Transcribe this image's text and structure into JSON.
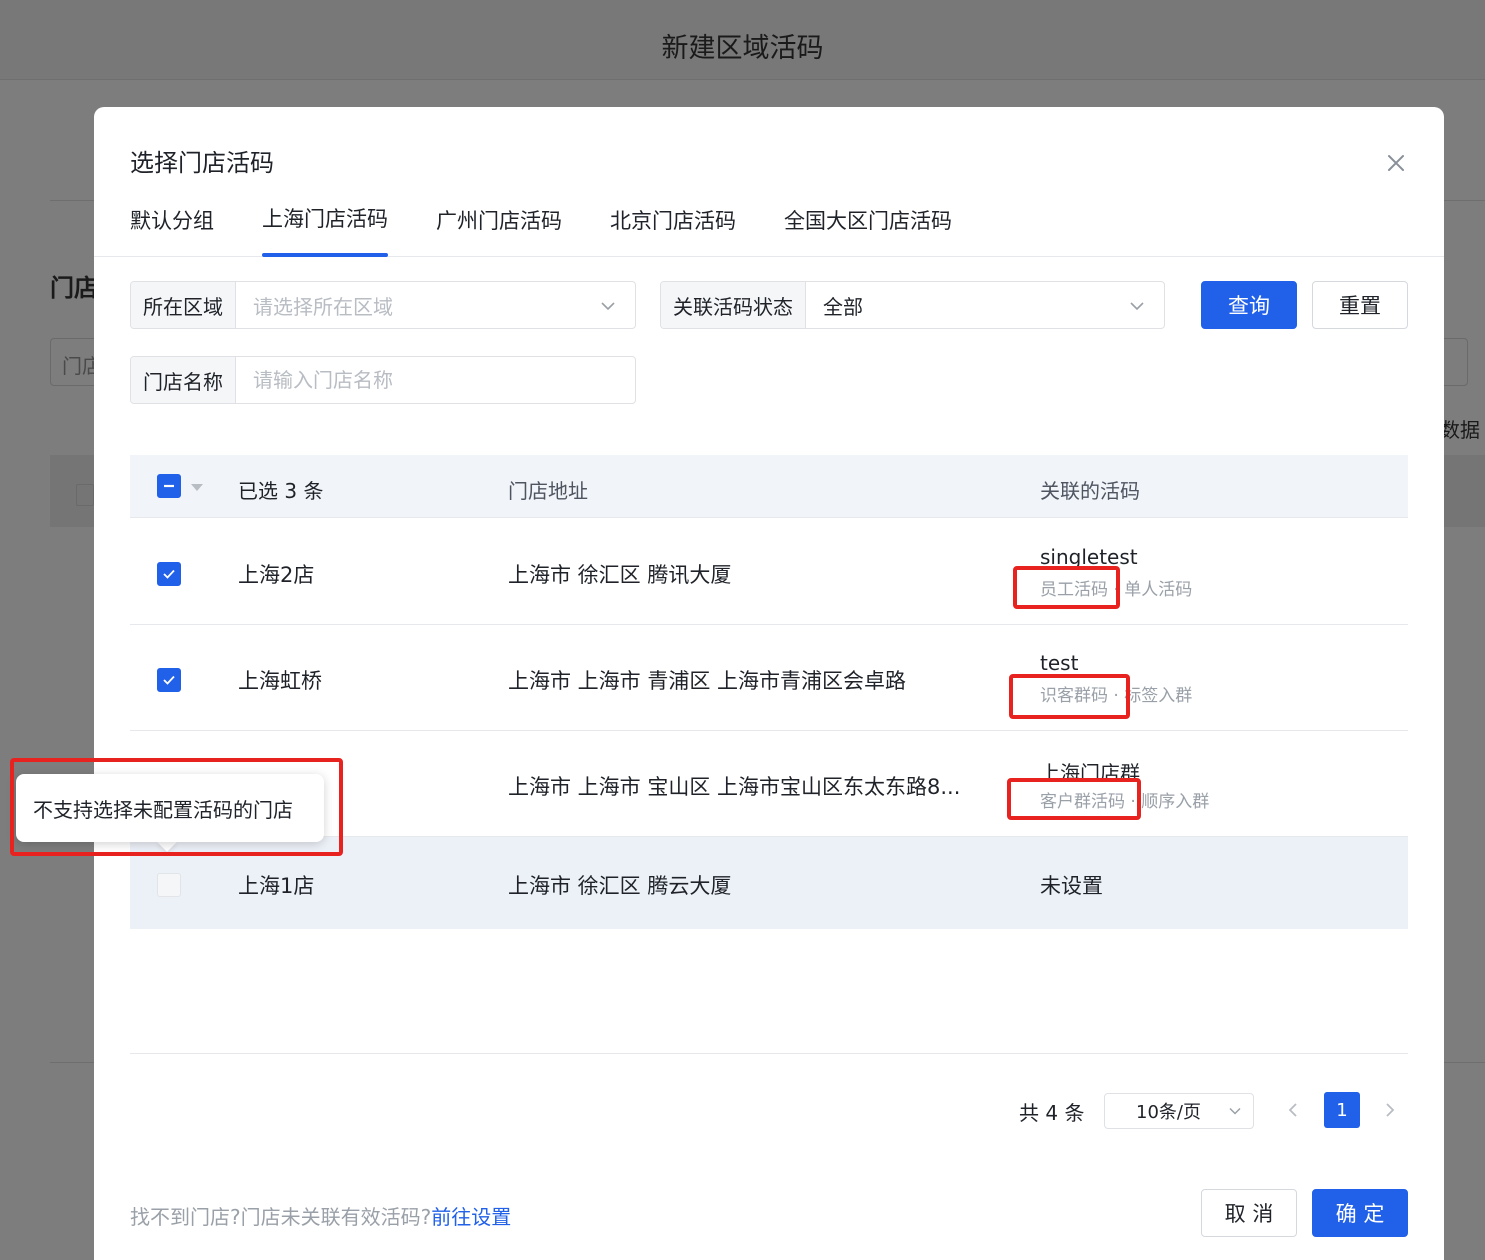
{
  "background": {
    "header_title": "新建区域活码",
    "section_title": "门店",
    "input_text": "门店",
    "side_text": "数据"
  },
  "modal": {
    "title": "选择门店活码",
    "tabs": [
      {
        "label": "默认分组"
      },
      {
        "label": "上海门店活码"
      },
      {
        "label": "广州门店活码"
      },
      {
        "label": "北京门店活码"
      },
      {
        "label": "全国大区门店活码"
      }
    ],
    "active_tab_index": 1,
    "filters": {
      "region": {
        "label": "所在区域",
        "placeholder": "请选择所在区域"
      },
      "status": {
        "label": "关联活码状态",
        "value": "全部"
      },
      "store_name": {
        "label": "门店名称",
        "placeholder": "请输入门店名称"
      }
    },
    "buttons": {
      "query": "查询",
      "reset": "重置",
      "cancel": "取 消",
      "confirm": "确 定"
    },
    "table": {
      "selected_label": "已选 3 条",
      "columns": {
        "address": "门店地址",
        "code": "关联的活码"
      },
      "rows": [
        {
          "name": "上海2店",
          "address": "上海市 徐汇区 腾讯大厦",
          "code_name": "singletest",
          "code_type": "员工活码",
          "code_mode": "单人活码",
          "checked": true
        },
        {
          "name": "上海虹桥",
          "address": "上海市 上海市 青浦区 上海市青浦区会卓路",
          "code_name": "test",
          "code_type": "识客群码",
          "code_mode": "标签入群",
          "checked": true
        },
        {
          "name": "",
          "address": "上海市 上海市 宝山区 上海市宝山区东太东路8...",
          "code_name": "上海门店群",
          "code_type": "客户群活码",
          "code_mode": "顺序入群",
          "checked": true
        },
        {
          "name": "上海1店",
          "address": "上海市 徐汇区 腾云大厦",
          "code_name": "未设置",
          "code_type": "",
          "code_mode": "",
          "checked": false
        }
      ]
    },
    "pagination": {
      "total": "共 4 条",
      "page_size": "10条/页",
      "current_page": "1"
    },
    "footer": {
      "hint": "找不到门店?门店未关联有效活码?",
      "link": "前往设置"
    },
    "tooltip": "不支持选择未配置活码的门店"
  },
  "colors": {
    "primary": "#2160e8",
    "annotation": "#e8231f",
    "overlay": "#7d7d7d"
  },
  "icons": [
    "close-icon",
    "chevron-down-icon",
    "check-icon",
    "minus-icon",
    "caret-down-icon",
    "chevron-left-icon",
    "chevron-right-icon"
  ]
}
